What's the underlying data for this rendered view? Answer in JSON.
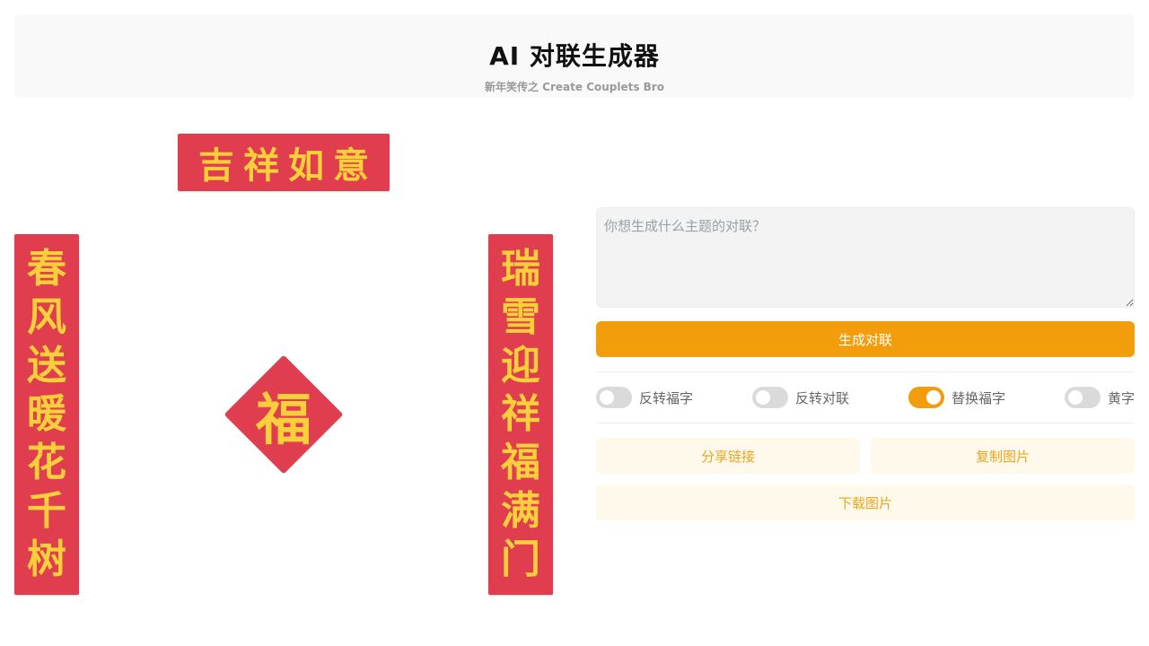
{
  "header": {
    "title": "AI 对联生成器",
    "subtitle": "新年笑传之 Create Couplets Bro"
  },
  "couplet": {
    "horizontal": "吉祥如意",
    "left": [
      "春",
      "风",
      "送",
      "暖",
      "花",
      "千",
      "树"
    ],
    "right": [
      "瑞",
      "雪",
      "迎",
      "祥",
      "福",
      "满",
      "门"
    ],
    "fu": "福"
  },
  "prompt": {
    "placeholder": "你想生成什么主题的对联？",
    "value": ""
  },
  "generate_label": "生成对联",
  "toggles": [
    {
      "label": "反转福字",
      "on": false
    },
    {
      "label": "反转对联",
      "on": false
    },
    {
      "label": "替换福字",
      "on": true
    },
    {
      "label": "黄字",
      "on": false
    }
  ],
  "actions": {
    "share_label": "分享链接",
    "copy_label": "复制图片",
    "download_label": "下载图片"
  },
  "colors": {
    "accent": "#f29e0c",
    "couplet_red": "#e03d4e",
    "couplet_gold": "#f9cf3b",
    "action_bg": "#fef9ea",
    "action_text": "#eaa51f"
  }
}
